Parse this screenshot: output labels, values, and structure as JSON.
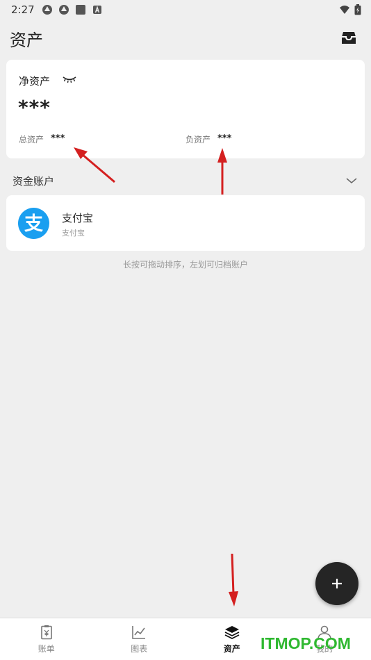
{
  "status": {
    "time": "2:27"
  },
  "header": {
    "title": "资产",
    "inbox_icon": "inbox-icon"
  },
  "net_assets": {
    "label": "净资产",
    "value": "***",
    "total_label": "总资产",
    "total_value": "***",
    "liability_label": "负资产",
    "liability_value": "***"
  },
  "accounts_section": {
    "title": "资金账户",
    "accounts": [
      {
        "name": "支付宝",
        "subtitle": "支付宝",
        "logo_char": "支",
        "logo_color": "#1a9ff0"
      }
    ],
    "hint": "长按可拖动排序，左划可归档账户"
  },
  "bottom_nav": {
    "items": [
      {
        "label": "账单",
        "icon": "clipboard-yen-icon",
        "active": false
      },
      {
        "label": "图表",
        "icon": "chart-icon",
        "active": false
      },
      {
        "label": "资产",
        "icon": "layers-icon",
        "active": true
      },
      {
        "label": "我的",
        "icon": "person-icon",
        "active": false
      }
    ]
  },
  "watermark": "ITMOP.COM",
  "colors": {
    "accent": "#1a9ff0",
    "arrow": "#d42020",
    "fab": "#252525",
    "watermark": "#2fb830"
  }
}
